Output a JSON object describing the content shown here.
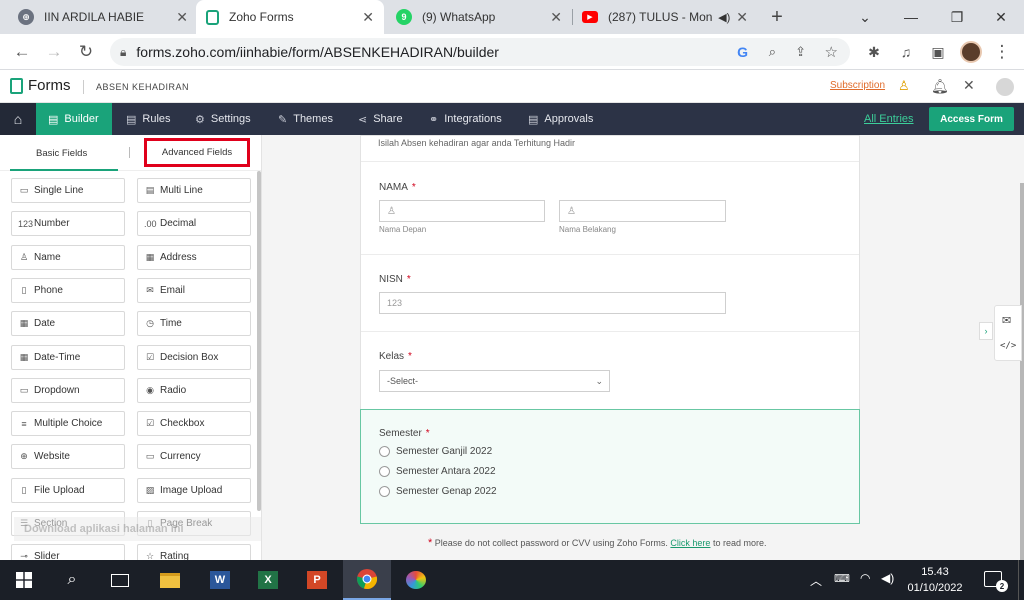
{
  "browser": {
    "tabs": [
      {
        "title": "IIN ARDILA HABIE",
        "icon": "globe-icon",
        "close": "✕"
      },
      {
        "title": "Zoho Forms",
        "icon": "zoho-forms-icon",
        "close": "✕"
      },
      {
        "title": "(9) WhatsApp",
        "icon": "whatsapp-icon",
        "badge": "9",
        "close": "✕"
      },
      {
        "title": "(287) TULUS - Mon",
        "icon": "youtube-icon",
        "close": "✕"
      }
    ],
    "new_tab": "+",
    "window": {
      "minimize": "⌄",
      "restore": "—",
      "maximize": "❐",
      "close": "✕"
    },
    "url": "forms.zoho.com/iinhabie/form/ABSENKEHADIRAN/builder"
  },
  "zoho": {
    "app_name": "Forms",
    "form_name": "ABSEN KEHADIRAN",
    "subscription": "Subscription",
    "toolbar": {
      "builder": "Builder",
      "rules": "Rules",
      "settings": "Settings",
      "themes": "Themes",
      "share": "Share",
      "integrations": "Integrations",
      "approvals": "Approvals",
      "all_entries": "All Entries",
      "access_form": "Access Form"
    },
    "left_panel": {
      "tab_basic": "Basic Fields",
      "tab_advanced": "Advanced Fields",
      "fields": [
        {
          "label": "Single Line",
          "icon": "single-line-icon",
          "glyph": "▭"
        },
        {
          "label": "Multi Line",
          "icon": "multi-line-icon",
          "glyph": "▤"
        },
        {
          "label": "Number",
          "icon": "number-icon",
          "glyph": "123"
        },
        {
          "label": "Decimal",
          "icon": "decimal-icon",
          "glyph": ".00"
        },
        {
          "label": "Name",
          "icon": "person-icon",
          "glyph": "♙"
        },
        {
          "label": "Address",
          "icon": "address-icon",
          "glyph": "▦"
        },
        {
          "label": "Phone",
          "icon": "phone-icon",
          "glyph": "▯"
        },
        {
          "label": "Email",
          "icon": "email-icon",
          "glyph": "✉"
        },
        {
          "label": "Date",
          "icon": "calendar-icon",
          "glyph": "▦"
        },
        {
          "label": "Time",
          "icon": "clock-icon",
          "glyph": "◷"
        },
        {
          "label": "Date-Time",
          "icon": "date-time-icon",
          "glyph": "▦"
        },
        {
          "label": "Decision Box",
          "icon": "checkbox-checked-icon",
          "glyph": "☑"
        },
        {
          "label": "Dropdown",
          "icon": "dropdown-icon",
          "glyph": "▭"
        },
        {
          "label": "Radio",
          "icon": "radio-icon",
          "glyph": "◉"
        },
        {
          "label": "Multiple Choice",
          "icon": "list-icon",
          "glyph": "≡"
        },
        {
          "label": "Checkbox",
          "icon": "checkbox-icon",
          "glyph": "☑"
        },
        {
          "label": "Website",
          "icon": "globe-icon",
          "glyph": "⊕"
        },
        {
          "label": "Currency",
          "icon": "currency-icon",
          "glyph": "▭"
        },
        {
          "label": "File Upload",
          "icon": "file-upload-icon",
          "glyph": "▯"
        },
        {
          "label": "Image Upload",
          "icon": "image-icon",
          "glyph": "▨"
        },
        {
          "label": "Section",
          "icon": "section-icon",
          "glyph": "☰"
        },
        {
          "label": "Page Break",
          "icon": "page-break-icon",
          "glyph": "▯"
        },
        {
          "label": "Slider",
          "icon": "slider-icon",
          "glyph": "⊸"
        },
        {
          "label": "Rating",
          "icon": "star-icon",
          "glyph": "☆"
        }
      ]
    },
    "form": {
      "description": "Isilah Absen kehadiran agar anda Terhitung Hadir",
      "nama": {
        "label": "NAMA",
        "required": "*",
        "first_sub": "Nama Depan",
        "last_sub": "Nama Belakang"
      },
      "nisn": {
        "label": "NISN",
        "required": "*",
        "placeholder": "123"
      },
      "kelas": {
        "label": "Kelas",
        "required": "*",
        "selected": "-Select-"
      },
      "semester": {
        "label": "Semester",
        "required": "*",
        "options": [
          "Semester Ganjil 2022",
          "Semester Antara 2022",
          "Semester Genap 2022"
        ]
      },
      "notice_star": "*",
      "notice": "Please do not collect password or CVV using Zoho Forms.",
      "notice_link": "Click here",
      "notice_end": "to read more."
    },
    "ghost_text": "Download aplikasi halaman ini"
  },
  "taskbar": {
    "apps": [
      "start-icon",
      "search-icon",
      "task-view-icon",
      "file-explorer-icon",
      "word-icon",
      "excel-icon",
      "powerpoint-icon",
      "chrome-icon",
      "paint-icon"
    ],
    "time": "15.43",
    "date": "01/10/2022",
    "notification_count": "2"
  },
  "colors": {
    "toolbar_bg": "#2c3346",
    "accent_green": "#1aa37a",
    "highlight_red": "#e0001b",
    "chrome_tabbar": "#dee1e6"
  }
}
